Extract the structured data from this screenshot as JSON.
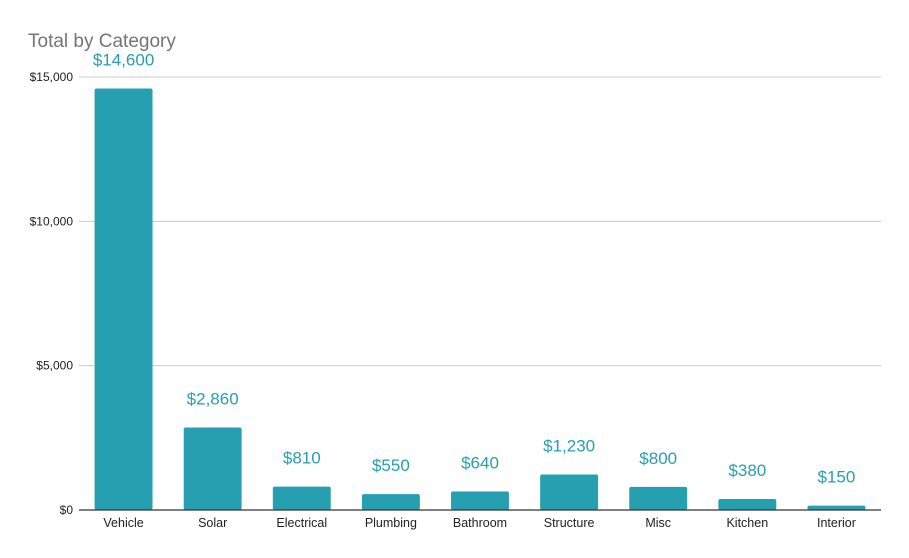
{
  "chart_data": {
    "type": "bar",
    "title": "Total by Category",
    "xlabel": "",
    "ylabel": "",
    "categories": [
      "Vehicle",
      "Solar",
      "Electrical",
      "Plumbing",
      "Bathroom",
      "Structure",
      "Misc",
      "Kitchen",
      "Interior"
    ],
    "values": [
      14600,
      2860,
      810,
      550,
      640,
      1230,
      800,
      380,
      150
    ],
    "data_labels": [
      "$14,600",
      "$2,860",
      "$810",
      "$550",
      "$640",
      "$1,230",
      "$800",
      "$380",
      "$150"
    ],
    "ylim": [
      0,
      15000
    ],
    "yticks": [
      0,
      5000,
      10000,
      15000
    ],
    "ytick_labels": [
      "$0",
      "$5,000",
      "$10,000",
      "$15,000"
    ],
    "grid": true,
    "legend": "none",
    "bar_color": "#26a0b0",
    "label_color": "#26a0b0"
  }
}
